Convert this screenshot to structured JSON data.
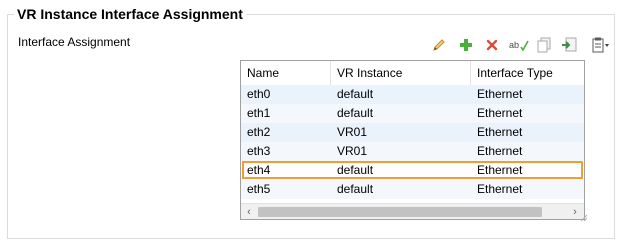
{
  "section": {
    "title": "VR Instance Interface Assignment",
    "field_label": "Interface Assignment"
  },
  "toolbar": {
    "items": [
      {
        "icon": "pencil-edit-icon",
        "color": "#d9a13b"
      },
      {
        "icon": "plus-add-icon",
        "color": "#4caf3c"
      },
      {
        "icon": "close-delete-icon",
        "color": "#d84b3c"
      },
      {
        "icon": "spellcheck-rename-icon",
        "color": "#556b2f"
      },
      {
        "icon": "copy-icon",
        "color": "#9a9a9a"
      },
      {
        "icon": "paste-import-icon",
        "color": "#3f8f3f"
      }
    ],
    "menu_icon": "clipboard-menu-icon"
  },
  "table": {
    "columns": [
      "Name",
      "VR Instance",
      "Interface Type"
    ],
    "rows": [
      [
        "eth0",
        "default",
        "Ethernet"
      ],
      [
        "eth1",
        "default",
        "Ethernet"
      ],
      [
        "eth2",
        "VR01",
        "Ethernet"
      ],
      [
        "eth3",
        "VR01",
        "Ethernet"
      ],
      [
        "eth4",
        "default",
        "Ethernet"
      ],
      [
        "eth5",
        "default",
        "Ethernet"
      ]
    ],
    "selected_row": 4,
    "colors": {
      "row": "#eaf2fb",
      "selection_border": "#f39c34"
    }
  },
  "scrollbar": {
    "left_arrow": "‹",
    "right_arrow": "›"
  }
}
